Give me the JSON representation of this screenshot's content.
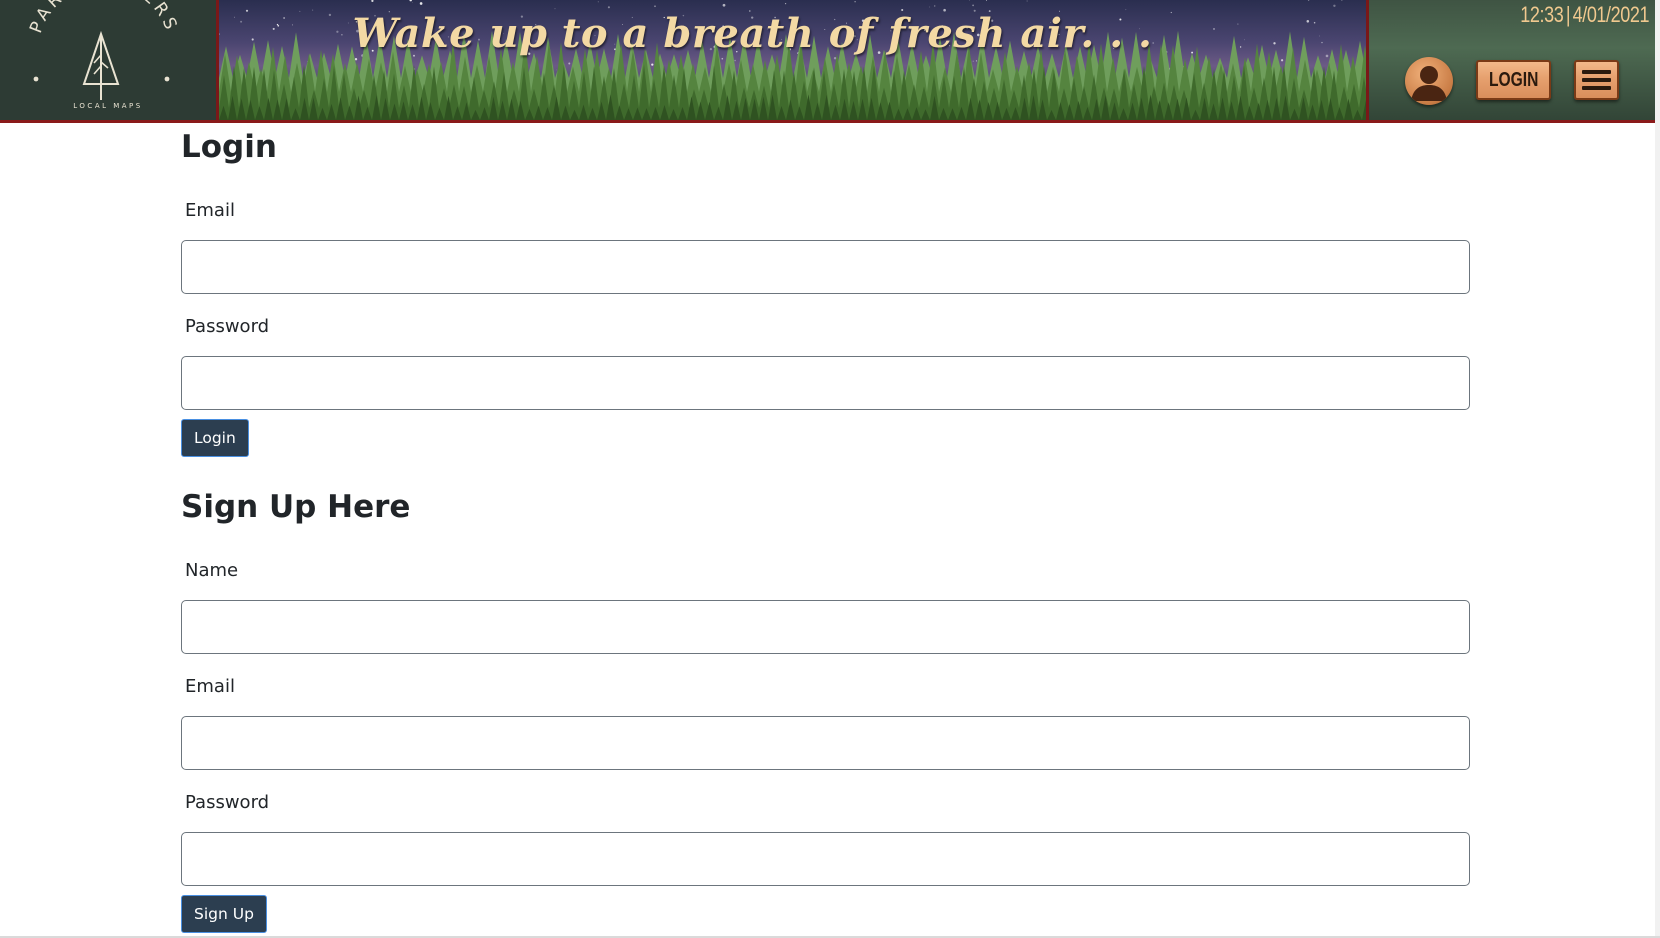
{
  "header": {
    "brand_name": "PARK FINDERS",
    "brand_subtitle": "LOCAL MAPS",
    "tagline": "Wake up to a breath of fresh air. . .",
    "time": "12:33",
    "separator": "|",
    "date": "4/01/2021",
    "avatar_icon": "user-avatar-icon",
    "login_label": "LOGIN",
    "menu_icon": "hamburger-menu-icon",
    "colors": {
      "border_red": "#8a1a1a",
      "tagline": "#f3d9a4",
      "clock": "#f1c98f",
      "wood": "#e6a06e"
    }
  },
  "login_form": {
    "title": "Login",
    "email_label": "Email",
    "email_value": "",
    "password_label": "Password",
    "password_value": "",
    "submit_label": "Login"
  },
  "signup_form": {
    "title": "Sign Up Here",
    "name_label": "Name",
    "name_value": "",
    "email_label": "Email",
    "email_value": "",
    "password_label": "Password",
    "password_value": "",
    "submit_label": "Sign Up"
  },
  "colors": {
    "button_bg": "#2c3e50",
    "button_border": "#4a90e2"
  }
}
